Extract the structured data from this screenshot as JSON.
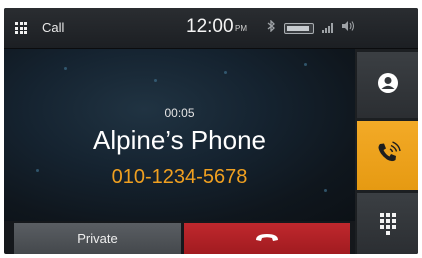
{
  "statusbar": {
    "app_label": "Call",
    "time": "12:00",
    "ampm": "PM",
    "icons": [
      "bluetooth-icon",
      "battery-icon",
      "signal-icon",
      "volume-icon"
    ]
  },
  "call": {
    "duration": "00:05",
    "caller_name": "Alpine’s Phone",
    "phone_number": "010-1234-5678"
  },
  "buttons": {
    "private_label": "Private",
    "end_call_icon": "hang-up-icon"
  },
  "sidebar": {
    "items": [
      {
        "icon": "contact-icon",
        "active": false
      },
      {
        "icon": "phone-call-icon",
        "active": true
      },
      {
        "icon": "keypad-icon",
        "active": false
      }
    ]
  },
  "colors": {
    "accent": "#f0a020",
    "end_call": "#b92228",
    "background": "#15181c"
  }
}
